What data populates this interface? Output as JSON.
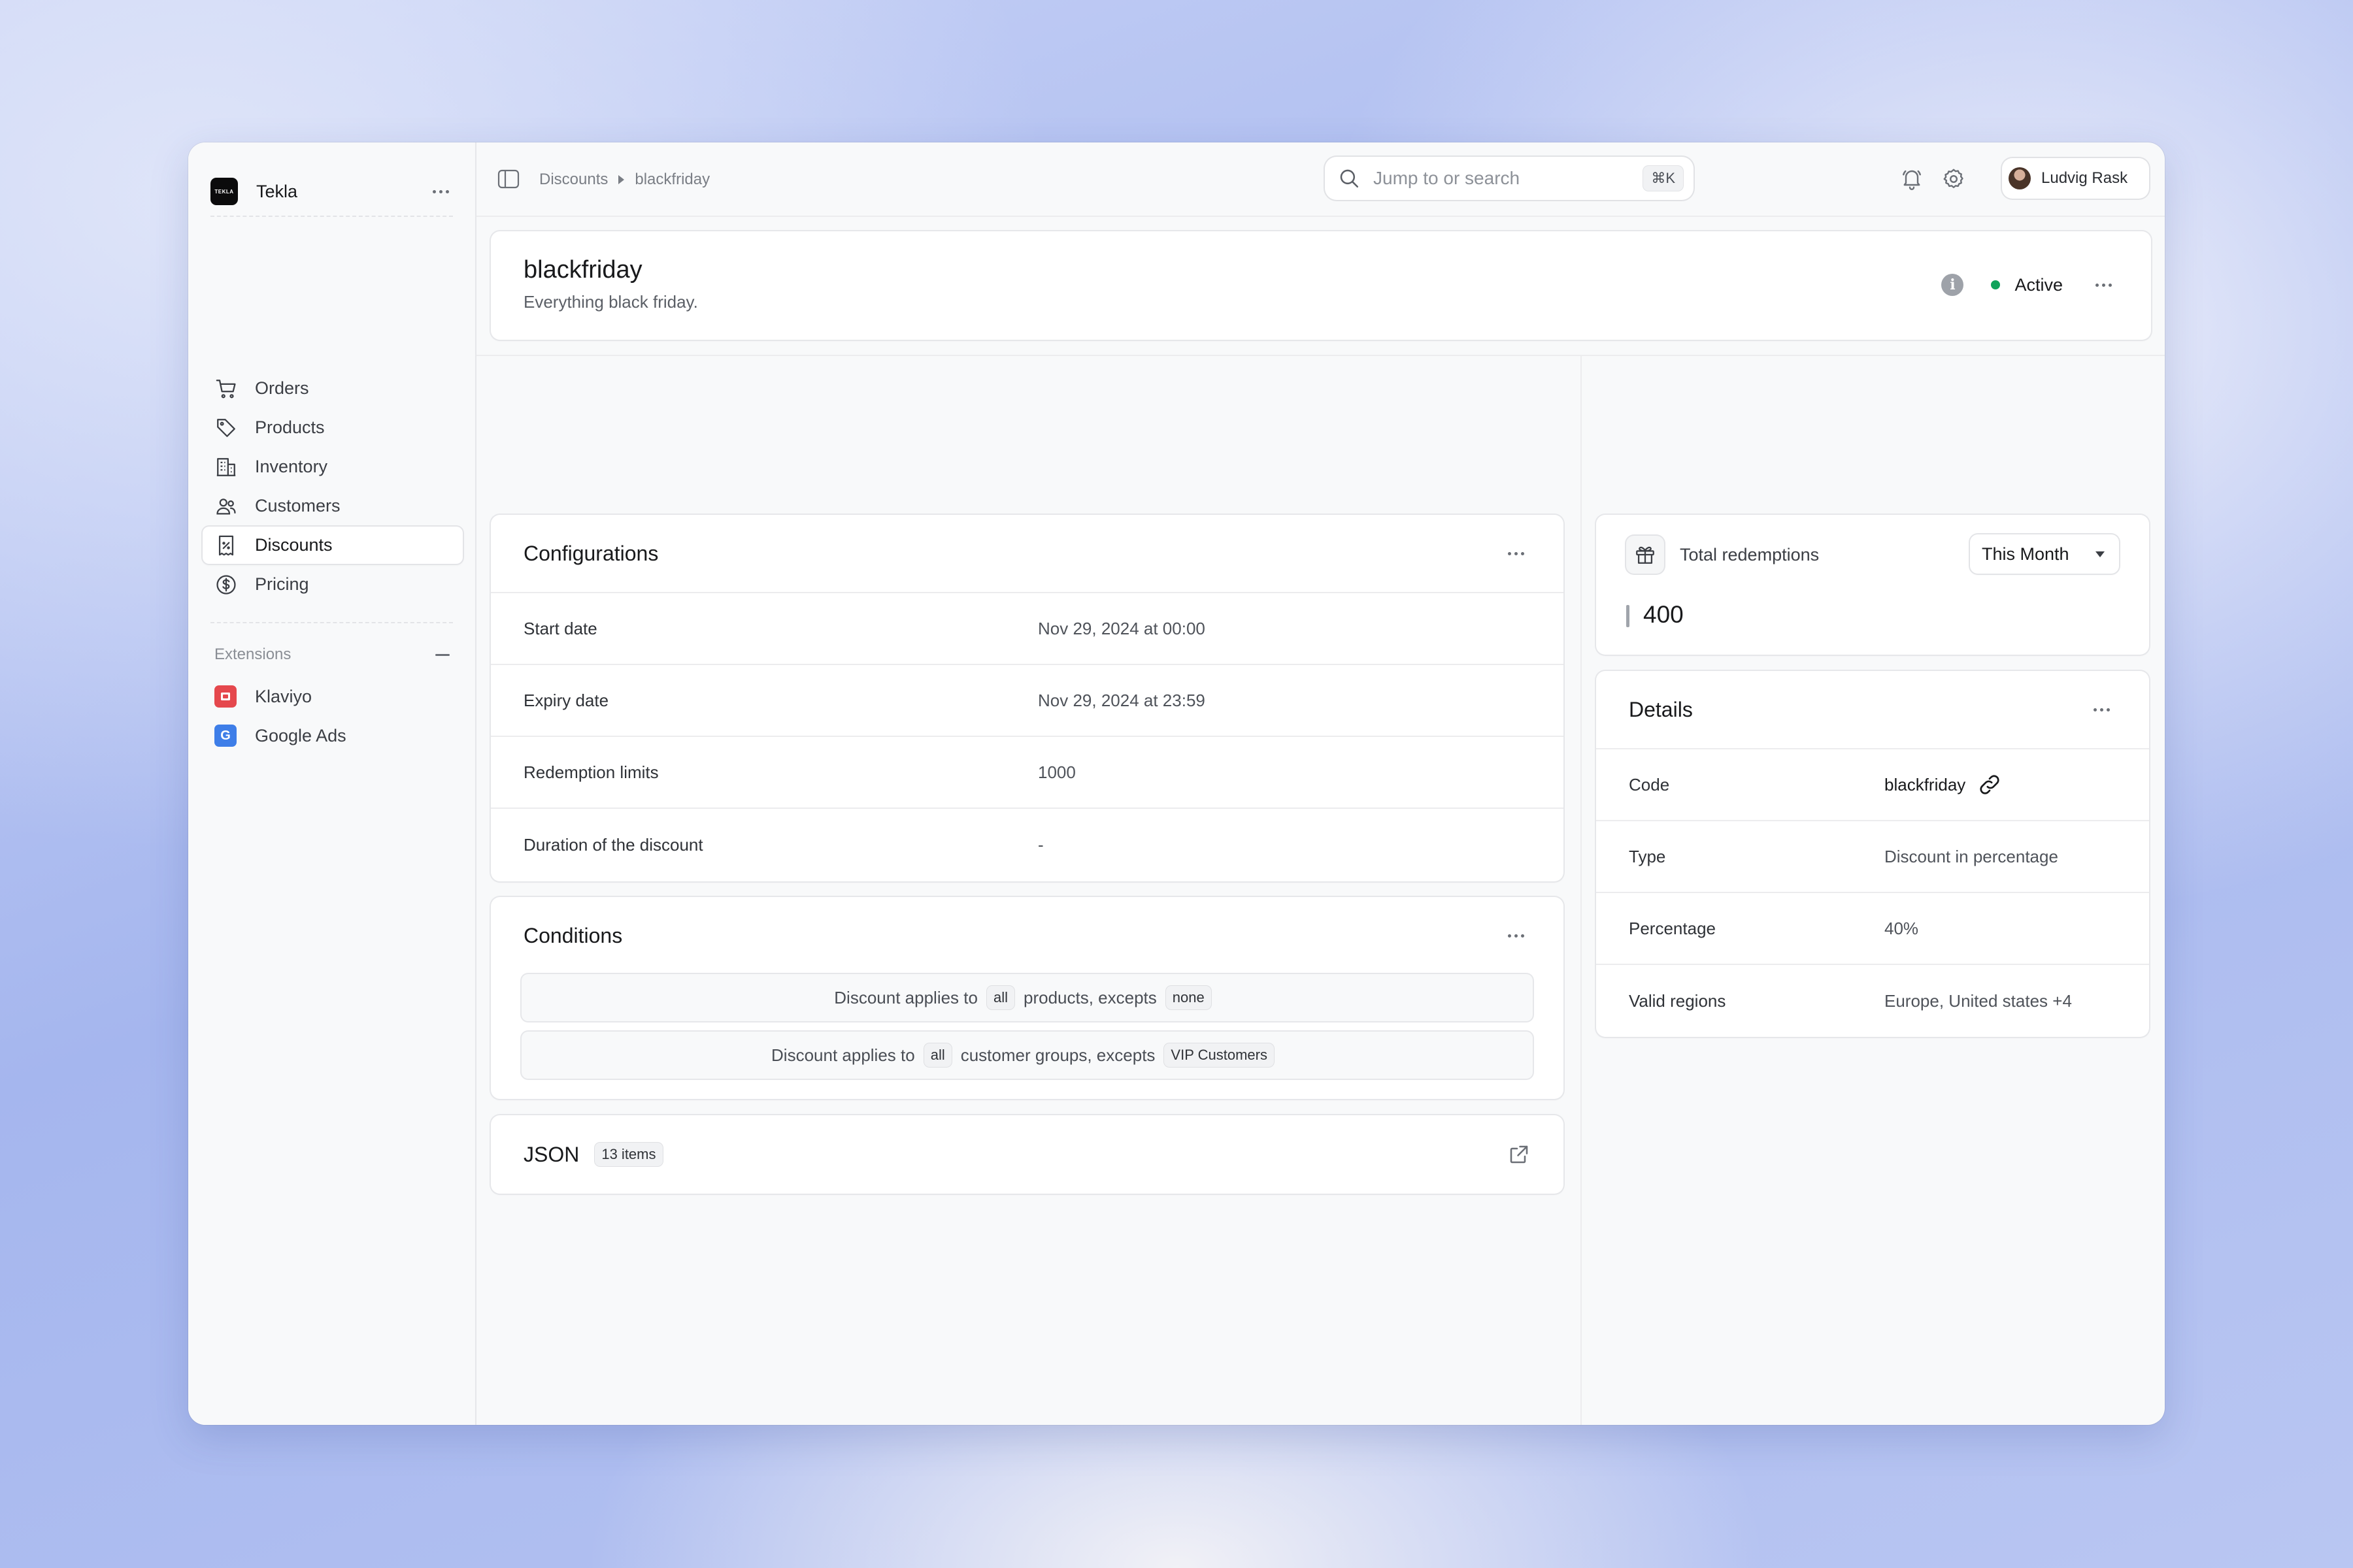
{
  "sidebar": {
    "brand": {
      "logo_text": "TEKLA",
      "name": "Tekla"
    },
    "nav": [
      {
        "label": "Orders",
        "icon": "cart-icon"
      },
      {
        "label": "Products",
        "icon": "tag-icon"
      },
      {
        "label": "Inventory",
        "icon": "building-icon"
      },
      {
        "label": "Customers",
        "icon": "users-icon"
      },
      {
        "label": "Discounts",
        "icon": "receipt-percent-icon",
        "active": true
      },
      {
        "label": "Pricing",
        "icon": "dollar-circle-icon"
      }
    ],
    "extensions_label": "Extensions",
    "extensions": [
      {
        "label": "Klaviyo",
        "icon": "klaviyo-icon",
        "color": "#e5484d"
      },
      {
        "label": "Google Ads",
        "icon": "google-ads-icon",
        "color": "#3e7ee8",
        "glyph": "G"
      }
    ]
  },
  "topbar": {
    "breadcrumb": [
      "Discounts",
      "blackfriday"
    ],
    "search_placeholder": "Jump to or search",
    "search_shortcut": "⌘K",
    "user_name": "Ludvig Rask"
  },
  "discount": {
    "title": "blackfriday",
    "subtitle": "Everything black friday.",
    "status": "Active",
    "status_color": "#10a35b"
  },
  "configurations": {
    "title": "Configurations",
    "rows": [
      {
        "label": "Start date",
        "value": "Nov 29, 2024 at 00:00"
      },
      {
        "label": "Expiry date",
        "value": "Nov 29, 2024 at 23:59"
      },
      {
        "label": "Redemption limits",
        "value": "1000"
      },
      {
        "label": "Duration of the discount",
        "value": "-"
      }
    ]
  },
  "conditions": {
    "title": "Conditions",
    "rules": [
      {
        "prefix": "Discount applies to",
        "scope": "all",
        "middle": "products, excepts",
        "exception": "none"
      },
      {
        "prefix": "Discount applies to",
        "scope": "all",
        "middle": "customer groups, excepts",
        "exception": "VIP Customers"
      }
    ]
  },
  "json": {
    "title": "JSON",
    "count_label": "13 items"
  },
  "redemptions": {
    "label": "Total redemptions",
    "period": "This Month",
    "value": "400"
  },
  "details": {
    "title": "Details",
    "rows": [
      {
        "label": "Code",
        "value": "blackfriday"
      },
      {
        "label": "Type",
        "value": "Discount in percentage"
      },
      {
        "label": "Percentage",
        "value": "40%"
      },
      {
        "label": "Valid regions",
        "value": "Europe, United states +4"
      }
    ]
  }
}
